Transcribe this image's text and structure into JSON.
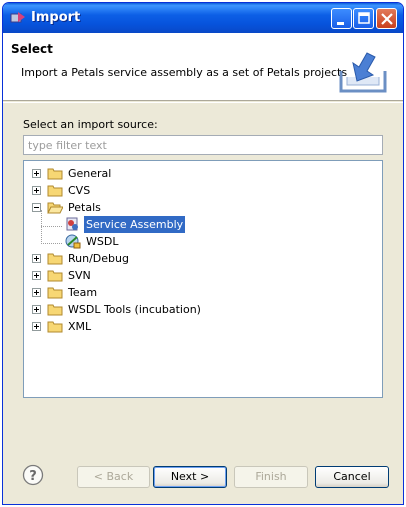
{
  "window": {
    "title": "Import"
  },
  "header": {
    "title": "Select",
    "description": "Import a Petals service assembly as a set of Petals projects"
  },
  "content": {
    "source_label": "Select an import source:",
    "filter_placeholder": "type filter text",
    "tree": [
      {
        "label": "General",
        "expanded": false,
        "icon": "folder-icon"
      },
      {
        "label": "CVS",
        "expanded": false,
        "icon": "folder-icon"
      },
      {
        "label": "Petals",
        "expanded": true,
        "icon": "folder-open-icon",
        "children": [
          {
            "label": "Service Assembly",
            "selected": true,
            "icon": "service-assembly-icon"
          },
          {
            "label": "WSDL",
            "selected": false,
            "icon": "wsdl-icon"
          }
        ]
      },
      {
        "label": "Run/Debug",
        "expanded": false,
        "icon": "folder-icon"
      },
      {
        "label": "SVN",
        "expanded": false,
        "icon": "folder-icon"
      },
      {
        "label": "Team",
        "expanded": false,
        "icon": "folder-icon"
      },
      {
        "label": "WSDL Tools (incubation)",
        "expanded": false,
        "icon": "folder-icon"
      },
      {
        "label": "XML",
        "expanded": false,
        "icon": "folder-icon"
      }
    ]
  },
  "buttons": {
    "back": "< Back",
    "next": "Next >",
    "finish": "Finish",
    "cancel": "Cancel"
  },
  "colors": {
    "titlebar": "#0a5ed8",
    "selection": "#316ac5",
    "dialog_bg": "#ece9d8"
  }
}
